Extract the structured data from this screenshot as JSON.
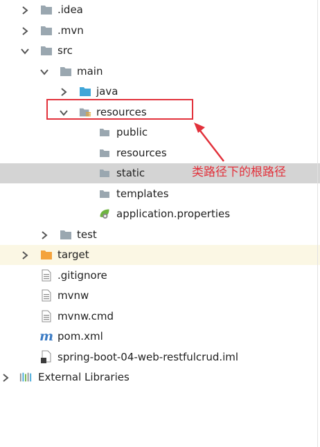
{
  "tree": {
    "items": [
      {
        "label": ".idea",
        "icon": "folder-gray",
        "expanded": false,
        "level": 1
      },
      {
        "label": ".mvn",
        "icon": "folder-gray",
        "expanded": false,
        "level": 1
      },
      {
        "label": "src",
        "icon": "folder-gray",
        "expanded": true,
        "level": 1
      },
      {
        "label": "main",
        "icon": "folder-gray",
        "expanded": true,
        "level": 2
      },
      {
        "label": "java",
        "icon": "folder-blue",
        "expanded": false,
        "level": 3
      },
      {
        "label": "resources",
        "icon": "folder-resources",
        "expanded": true,
        "level": 3
      },
      {
        "label": "public",
        "icon": "folder-small",
        "level": 4
      },
      {
        "label": "resources",
        "icon": "folder-small",
        "level": 4
      },
      {
        "label": "static",
        "icon": "folder-small",
        "level": 4,
        "selected": true
      },
      {
        "label": "templates",
        "icon": "folder-small",
        "level": 4
      },
      {
        "label": "application.properties",
        "icon": "spring-leaf",
        "level": 4
      },
      {
        "label": "test",
        "icon": "folder-gray",
        "expanded": false,
        "level": 2
      },
      {
        "label": "target",
        "icon": "folder-orange",
        "expanded": false,
        "level": 1,
        "excluded": true
      },
      {
        "label": ".gitignore",
        "icon": "text-file",
        "level": 1
      },
      {
        "label": "mvnw",
        "icon": "text-file",
        "level": 1
      },
      {
        "label": "mvnw.cmd",
        "icon": "text-file",
        "level": 1
      },
      {
        "label": "pom.xml",
        "icon": "maven-m",
        "level": 1
      },
      {
        "label": "spring-boot-04-web-restfulcrud.iml",
        "icon": "iml-file",
        "level": 1
      },
      {
        "label": "External Libraries",
        "icon": "libraries",
        "expanded": false,
        "level": 0
      }
    ]
  },
  "annotation": {
    "text": "类路径下的根路径",
    "color": "#e2313b"
  },
  "colors": {
    "selected_row": "#d4d4d4",
    "excluded_row": "#fbf7e4",
    "folder_gray": "#9aa7b0",
    "folder_blue": "#40a6d8",
    "folder_orange": "#f4a33c"
  }
}
